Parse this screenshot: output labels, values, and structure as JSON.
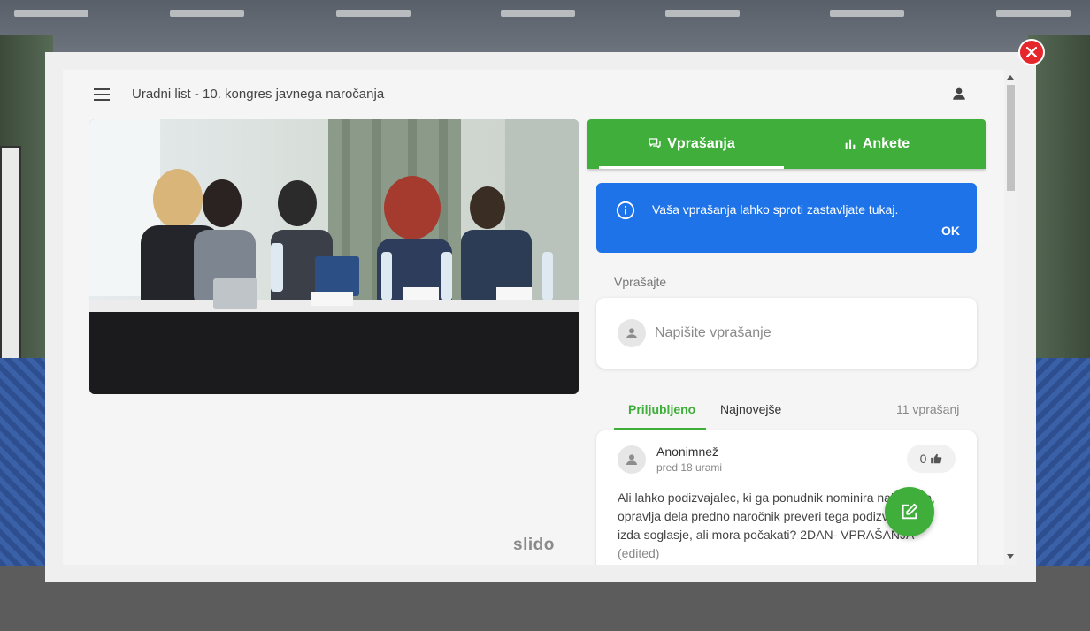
{
  "header": {
    "title": "Uradni list - 10. kongres javnega naročanja"
  },
  "video": {
    "brand": "slido"
  },
  "tabs": [
    {
      "label": "Vprašanja",
      "icon": "chat-bubbles-icon"
    },
    {
      "label": "Ankete",
      "icon": "bar-chart-icon"
    }
  ],
  "info_banner": {
    "text": "Vaša vprašanja lahko sproti zastavljate tukaj.",
    "ok_label": "OK"
  },
  "ask": {
    "label": "Vprašajte",
    "placeholder": "Napišite vprašanje"
  },
  "sort": {
    "popular": "Priljubljeno",
    "newest": "Najnovejše",
    "count": "11 vprašanj"
  },
  "question": {
    "author": "Anonimnež",
    "time": "pred 18 urami",
    "likes": "0",
    "text": "Ali lahko podizvajalec, ki ga ponudnik nominira naknadno, opravlja dela predno naročnik preveri tega podizvajalca in izda soglasje, ali mora počakati? 2DAN- VPRAŠANJA",
    "edited": "(edited)"
  },
  "colors": {
    "brand_green": "#3fae3a",
    "info_blue": "#1e73e8",
    "close_red": "#e5262b"
  }
}
